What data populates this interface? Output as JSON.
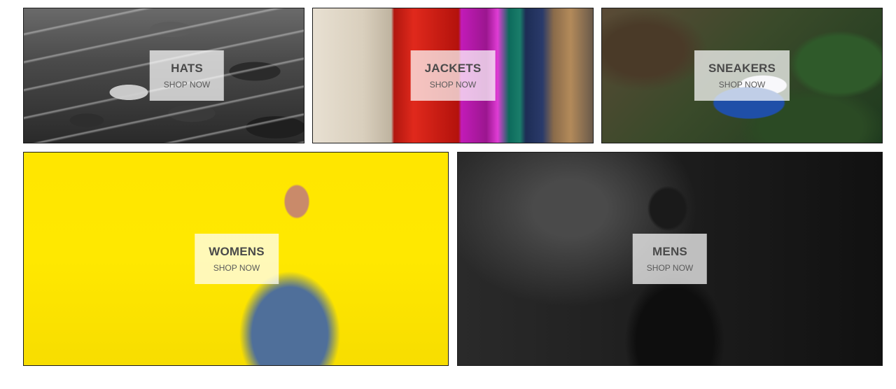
{
  "directory": {
    "sections": [
      {
        "title": "HATS",
        "cta": "SHOP NOW"
      },
      {
        "title": "JACKETS",
        "cta": "SHOP NOW"
      },
      {
        "title": "SNEAKERS",
        "cta": "SHOP NOW"
      },
      {
        "title": "WOMENS",
        "cta": "SHOP NOW"
      },
      {
        "title": "MENS",
        "cta": "SHOP NOW"
      }
    ]
  },
  "colors": {
    "label_background": "#ffffffb8",
    "label_text": "#4a4a4a",
    "tile_border": "#1a1a1a"
  }
}
